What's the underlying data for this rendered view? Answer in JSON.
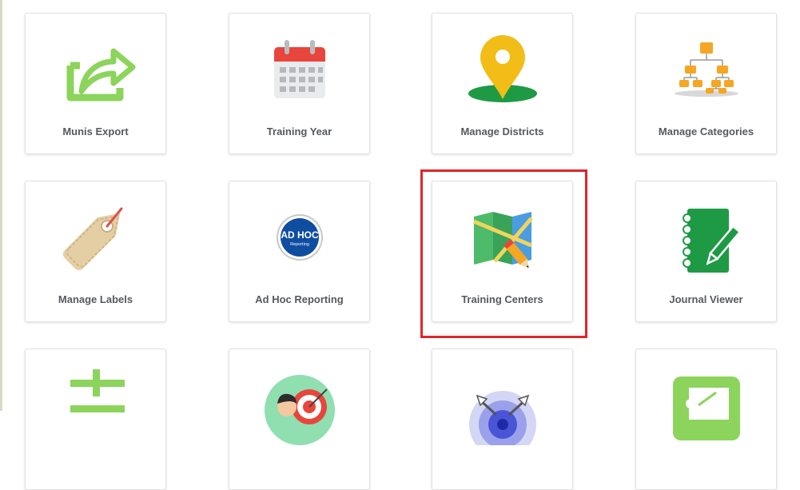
{
  "tiles": [
    {
      "label": "Munis Export",
      "icon": "export-share-icon"
    },
    {
      "label": "Training Year",
      "icon": "calendar-icon"
    },
    {
      "label": "Manage Districts",
      "icon": "map-pin-icon"
    },
    {
      "label": "Manage Categories",
      "icon": "hierarchy-icon"
    },
    {
      "label": "Manage Labels",
      "icon": "price-tag-icon"
    },
    {
      "label": "Ad Hoc Reporting",
      "icon": "ad-hoc-badge-icon",
      "badge_text": "AD HOC",
      "badge_subtext": "Reporting"
    },
    {
      "label": "Training Centers",
      "icon": "map-pencil-icon"
    },
    {
      "label": "Journal Viewer",
      "icon": "notebook-pencil-icon"
    },
    {
      "label": "",
      "icon": "plus-list-icon"
    },
    {
      "label": "",
      "icon": "person-target-icon"
    },
    {
      "label": "",
      "icon": "target-arrows-icon"
    },
    {
      "label": "",
      "icon": "teacher-board-icon"
    }
  ],
  "highlighted_tile": "Training Centers",
  "colors": {
    "highlight": "#e0262a",
    "label": "#555a60",
    "tile_border": "#e2e2e2"
  }
}
